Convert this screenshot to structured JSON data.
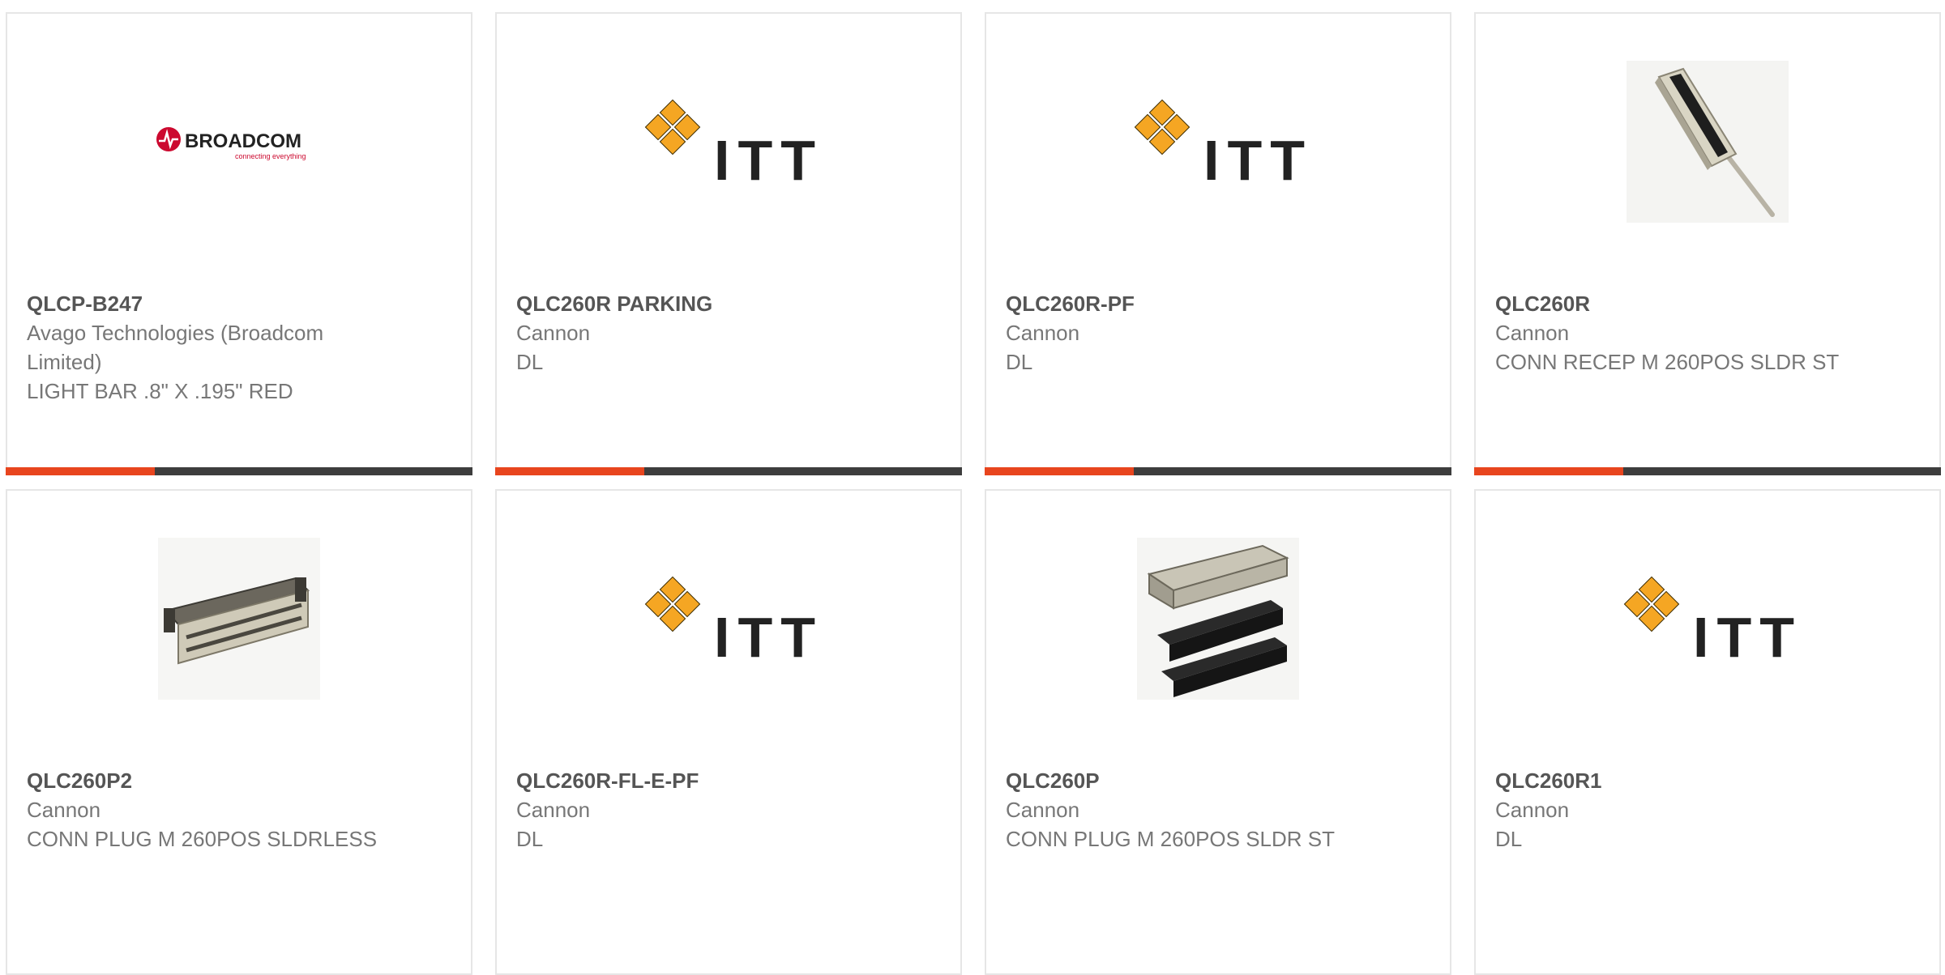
{
  "products": [
    {
      "part": "QLCP-B247",
      "manufacturer": "Avago Technologies (Broadcom Limited)",
      "description": "LIGHT BAR .8\" X .195\" RED",
      "image": "broadcom-logo",
      "logo_text": "BROADCOM",
      "logo_tagline": "connecting everything"
    },
    {
      "part": "QLC260R PARKING",
      "manufacturer": "Cannon",
      "description": "DL",
      "image": "itt-logo",
      "logo_text": "ITT"
    },
    {
      "part": "QLC260R-PF",
      "manufacturer": "Cannon",
      "description": "DL",
      "image": "itt-logo",
      "logo_text": "ITT"
    },
    {
      "part": "QLC260R",
      "manufacturer": "Cannon",
      "description": "CONN RECEP M 260POS SLDR ST",
      "image": "connector-receptacle-photo"
    },
    {
      "part": "QLC260P2",
      "manufacturer": "Cannon",
      "description": "CONN PLUG M 260POS SLDRLESS",
      "image": "connector-plug-photo"
    },
    {
      "part": "QLC260R-FL-E-PF",
      "manufacturer": "Cannon",
      "description": "DL",
      "image": "itt-logo",
      "logo_text": "ITT"
    },
    {
      "part": "QLC260P",
      "manufacturer": "Cannon",
      "description": "CONN PLUG M 260POS SLDR ST",
      "image": "connector-plug-set-photo"
    },
    {
      "part": "QLC260R1",
      "manufacturer": "Cannon",
      "description": "DL",
      "image": "itt-logo",
      "logo_text": "ITT"
    }
  ],
  "colors": {
    "accent": "#e8451e",
    "bar": "#3d3d3d",
    "itt_gold": "#f5a623",
    "broadcom_red": "#cc092f"
  }
}
